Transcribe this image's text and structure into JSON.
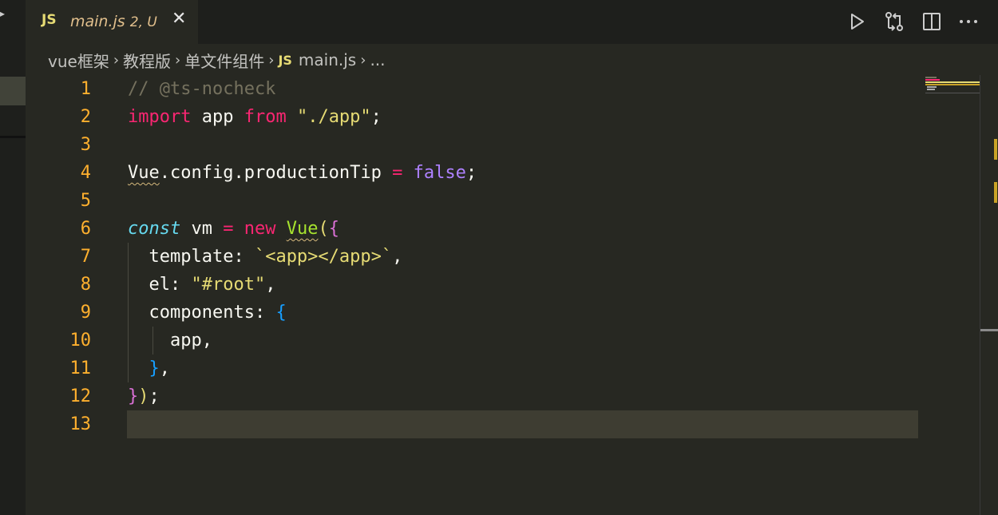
{
  "tab": {
    "icon_text": "JS",
    "file_name": "main.js",
    "status": "2, U",
    "close_glyph": "✕"
  },
  "breadcrumb": {
    "segments": [
      "vue框架",
      "教程版",
      "单文件组件"
    ],
    "file_icon_text": "JS",
    "file": "main.js",
    "ellipsis": "..."
  },
  "editor": {
    "line_numbers": [
      "1",
      "2",
      "3",
      "4",
      "5",
      "6",
      "7",
      "8",
      "9",
      "10",
      "11",
      "12",
      "13"
    ],
    "current_line": 13,
    "lines": [
      [
        {
          "t": "// @ts-nocheck",
          "c": "comment"
        }
      ],
      [
        {
          "t": "import",
          "c": "kw"
        },
        {
          "t": " app ",
          "c": ""
        },
        {
          "t": "from",
          "c": "kw"
        },
        {
          "t": " ",
          "c": ""
        },
        {
          "t": "\"./app\"",
          "c": "str"
        },
        {
          "t": ";",
          "c": ""
        }
      ],
      [],
      [
        {
          "t": "Vue",
          "c": "squiggle"
        },
        {
          "t": ".config.productionTip ",
          "c": ""
        },
        {
          "t": "=",
          "c": "kw"
        },
        {
          "t": " ",
          "c": ""
        },
        {
          "t": "false",
          "c": "bool"
        },
        {
          "t": ";",
          "c": ""
        }
      ],
      [],
      [
        {
          "t": "const",
          "c": "const"
        },
        {
          "t": " vm ",
          "c": ""
        },
        {
          "t": "=",
          "c": "kw"
        },
        {
          "t": " ",
          "c": ""
        },
        {
          "t": "new",
          "c": "kw"
        },
        {
          "t": " ",
          "c": ""
        },
        {
          "t": "Vue",
          "c": "class squiggle"
        },
        {
          "t": "(",
          "c": "str"
        },
        {
          "t": "{",
          "c": "brace1"
        }
      ],
      [
        {
          "t": "  template: ",
          "c": ""
        },
        {
          "t": "`<app></app>`",
          "c": "str"
        },
        {
          "t": ",",
          "c": ""
        }
      ],
      [
        {
          "t": "  el: ",
          "c": ""
        },
        {
          "t": "\"#root\"",
          "c": "str"
        },
        {
          "t": ",",
          "c": ""
        }
      ],
      [
        {
          "t": "  components: ",
          "c": ""
        },
        {
          "t": "{",
          "c": "brace2"
        }
      ],
      [
        {
          "t": "    app,",
          "c": ""
        }
      ],
      [
        {
          "t": "  ",
          "c": ""
        },
        {
          "t": "}",
          "c": "brace2"
        },
        {
          "t": ",",
          "c": ""
        }
      ],
      [
        {
          "t": "}",
          "c": "brace1"
        },
        {
          "t": ")",
          "c": "str"
        },
        {
          "t": ";",
          "c": ""
        }
      ],
      []
    ]
  },
  "actions": [
    {
      "name": "run-icon"
    },
    {
      "name": "source-compare-icon"
    },
    {
      "name": "split-editor-icon"
    },
    {
      "name": "more-actions-icon"
    }
  ],
  "colors": {
    "background": "#272822",
    "line_number": "#ffb02e",
    "keyword": "#f92672",
    "string": "#e6db74",
    "comment": "#75715e"
  }
}
